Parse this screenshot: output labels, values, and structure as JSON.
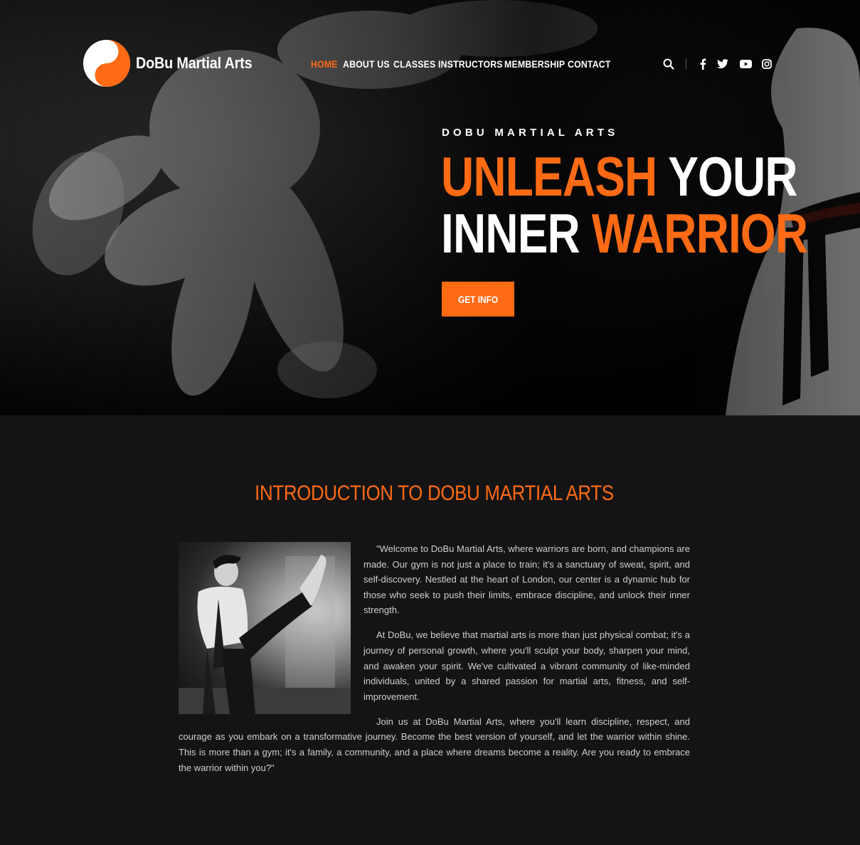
{
  "brand": {
    "name": "DoBu Martial Arts",
    "accent": "#ff6a14"
  },
  "nav": {
    "items": [
      {
        "label": "HOME",
        "active": true
      },
      {
        "label": "ABOUT US",
        "active": false
      },
      {
        "label": "CLASSES",
        "active": false
      },
      {
        "label": "INSTRUCTORS",
        "active": false
      },
      {
        "label": "MEMBERSHIP",
        "active": false
      },
      {
        "label": "CONTACT",
        "active": false
      }
    ]
  },
  "tools": {
    "icons": [
      "search-icon",
      "facebook-icon",
      "twitter-icon",
      "youtube-icon",
      "instagram-icon"
    ]
  },
  "hero": {
    "kicker": "DOBU MARTIAL ARTS",
    "headline_line1_orange": "UNLEASH",
    "headline_line1_white": "YOUR",
    "headline_line2_white": "INNER",
    "headline_line2_orange": "WARRIOR",
    "cta_label": "GET INFO"
  },
  "intro": {
    "title": "INTRODUCTION TO DOBU MARTIAL ARTS",
    "paragraphs": [
      "\"Welcome to DoBu Martial Arts, where warriors are born, and champions are made. Our gym is not just a place to train; it's a sanctuary of sweat, spirit, and self-discovery. Nestled at the heart of London, our center is a dynamic hub for those who seek to push their limits, embrace discipline, and unlock their inner strength.",
      "At DoBu, we believe that martial arts is more than just physical combat; it's a journey of personal growth, where you'll sculpt your body, sharpen your mind, and awaken your spirit. We've cultivated a vibrant community of like-minded individuals, united by a shared passion for martial arts, fitness, and self-improvement.",
      "Join us at DoBu Martial Arts, where you'll learn discipline, respect, and courage as you embark on a transformative journey. Become the best version of yourself, and let the warrior within shine. This is more than a gym; it's a family, a community, and a place where dreams become a reality. Are you ready to embrace the warrior within you?\""
    ]
  }
}
